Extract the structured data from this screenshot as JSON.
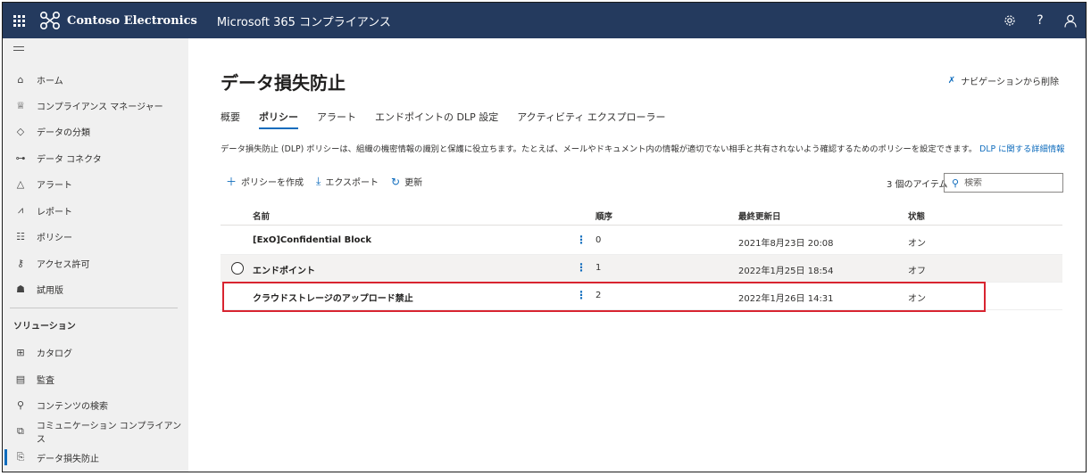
{
  "topbar": {
    "brand_name": "Contoso Electronics",
    "app_name": "Microsoft 365 コンプライアンス",
    "icons": [
      "waffle-icon",
      "gear-icon",
      "help-icon",
      "person-icon"
    ],
    "help_glyph": "?"
  },
  "sidebar": {
    "items": [
      {
        "label": "ホーム",
        "icon": "home-icon"
      },
      {
        "label": "コンプライアンス マネージャー",
        "icon": "trophy-icon"
      },
      {
        "label": "データの分類",
        "icon": "tag-icon"
      },
      {
        "label": "データ コネクタ",
        "icon": "connector-icon"
      },
      {
        "label": "アラート",
        "icon": "warning-icon"
      },
      {
        "label": "レポート",
        "icon": "chart-icon"
      },
      {
        "label": "ポリシー",
        "icon": "sliders-icon"
      },
      {
        "label": "アクセス許可",
        "icon": "key-icon"
      },
      {
        "label": "試用版",
        "icon": "trial-icon"
      }
    ],
    "section_label": "ソリューション",
    "solution_items": [
      {
        "label": "カタログ",
        "icon": "catalog-icon"
      },
      {
        "label": "監査",
        "icon": "audit-icon"
      },
      {
        "label": "コンテンツの検索",
        "icon": "search-icon"
      },
      {
        "label": "コミュニケーション コンプライアンス",
        "icon": "chat-icon"
      },
      {
        "label": "データ損失防止",
        "icon": "dlp-icon",
        "active": true
      }
    ]
  },
  "main": {
    "title": "データ損失防止",
    "remove_nav_label": "ナビゲーションから削除",
    "tabs": [
      {
        "label": "概要"
      },
      {
        "label": "ポリシー",
        "active": true
      },
      {
        "label": "アラート"
      },
      {
        "label": "エンドポイントの DLP 設定"
      },
      {
        "label": "アクティビティ エクスプローラー"
      }
    ],
    "description": "データ損失防止 (DLP) ポリシーは、組織の機密情報の識別と保護に役立ちます。たとえば、メールやドキュメント内の情報が適切でない相手と共有されないよう確認するためのポリシーを設定できます。",
    "description_link": "DLP に関する詳細情報",
    "toolbar": {
      "create_label": "ポリシーを作成",
      "export_label": "エクスポート",
      "refresh_label": "更新"
    },
    "item_count": "3 個のアイテム",
    "search_placeholder": "検索",
    "table": {
      "columns": [
        "名前",
        "順序",
        "最終更新日",
        "状態"
      ],
      "rows": [
        {
          "name": "[ExO]Confidential Block",
          "order": "0",
          "modified": "2021年8月23日 20:08",
          "status": "オン"
        },
        {
          "name": "エンドポイント",
          "order": "1",
          "modified": "2022年1月25日 18:54",
          "status": "オフ"
        },
        {
          "name": "クラウドストレージのアップロード禁止",
          "order": "2",
          "modified": "2022年1月26日 14:31",
          "status": "オン"
        }
      ]
    }
  }
}
